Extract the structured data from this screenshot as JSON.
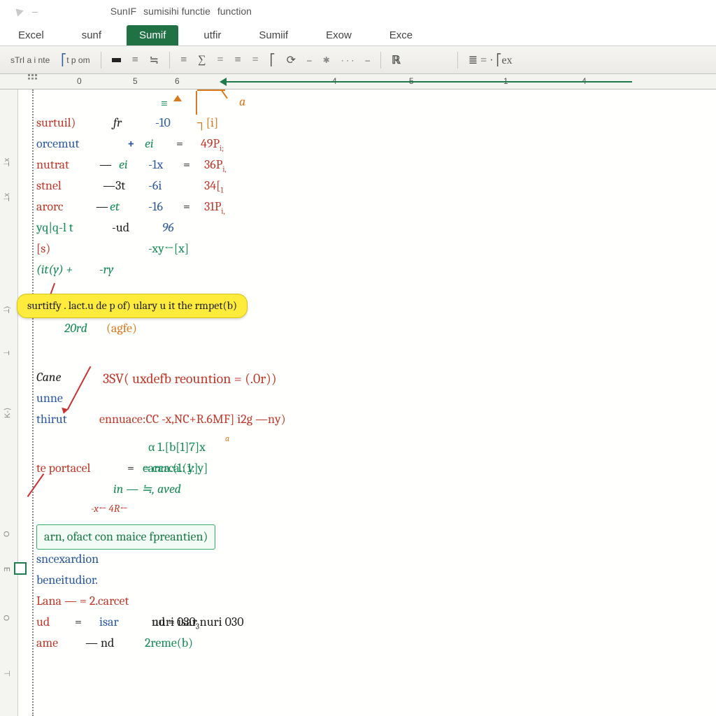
{
  "title": {
    "app": "SunIF",
    "sub": "sumisihi functie",
    "doc": "function"
  },
  "tabs": [
    "Excel",
    "sunf",
    "Sumif",
    "utfir",
    "Sumiif",
    "Exow",
    "Exce"
  ],
  "activeTab": 2,
  "ribbon": {
    "left_text": "sTrI a i nte",
    "group1": "t  p  om",
    "math": [
      "≡",
      "≒",
      "≡",
      "∑",
      "=",
      "≡",
      "=",
      "⎡",
      "⟳"
    ],
    "mid_dots": "· · ·",
    "right1": "ℝ",
    "right2": "≣ = · ⎡ex",
    "dash": "–"
  },
  "column_headers": {
    "a": "0",
    "b": "5",
    "c": "6",
    "d": "4",
    "e": "5",
    "f": "1",
    "g": "4"
  },
  "rows": [
    {
      "a": "surtuil)",
      "b": "fr",
      "c": "-10",
      "d": "┐[i]",
      "glyph": "≡",
      "tag": "a"
    },
    {
      "a": "orcemut",
      "b": "+",
      "c": "ei",
      "d": "=",
      "e": "49P",
      "sub": "i;"
    },
    {
      "a": "nutrat",
      "b": "—",
      "c": "ei",
      "d": "-1x",
      "e": "=",
      "f": "36P",
      "sub": "i,"
    },
    {
      "a": "stnel",
      "b": "—3t",
      "c": "-6i",
      "d": "",
      "e": "34[",
      "sub": "1"
    },
    {
      "a": "arorc",
      "b": "—et",
      "c": "-16",
      "d": "=",
      "e": "31P",
      "sub": "i,"
    },
    {
      "a": "yq|q-l t",
      "b": "-ud",
      "c": "96"
    },
    {
      "a": "[s)",
      "c": "-xy←[x]"
    },
    {
      "a": "(it(y) +",
      "b": "-ry"
    }
  ],
  "highlight": "surtitfy . lact.u de p of) ulary u it the rmpet(b)",
  "note1": {
    "a": "20rd",
    "b": "(agfe)"
  },
  "section": {
    "cane": "Cane",
    "formula": "3SV( uxdefb reountion = (.0r))",
    "unne": "unne",
    "thit": "thirut",
    "enn": "ennuace:CC -x,NC+R.6MF] i2g —ny)",
    "alpha": "α 1.[b[1]7]x",
    "te": "te portacel",
    "carc": "= carca.(1: y]",
    "in": "in — ≒, aved",
    "xforty": "-x← 4R←",
    "greenln": "arn,  ofact  con maice fpreantien)",
    "list": [
      "sncexardion",
      "beneitudior.",
      "Lana  —  = 2.carcet",
      "ud  =  isar    nuri 030",
      "ame  — nd    2reme(b)"
    ]
  },
  "gutter_labels": [
    "⟘x",
    "⟘x",
    "⟘⟩",
    "⟘",
    "K-⟩",
    "O",
    "∃",
    "O",
    "⊥"
  ]
}
